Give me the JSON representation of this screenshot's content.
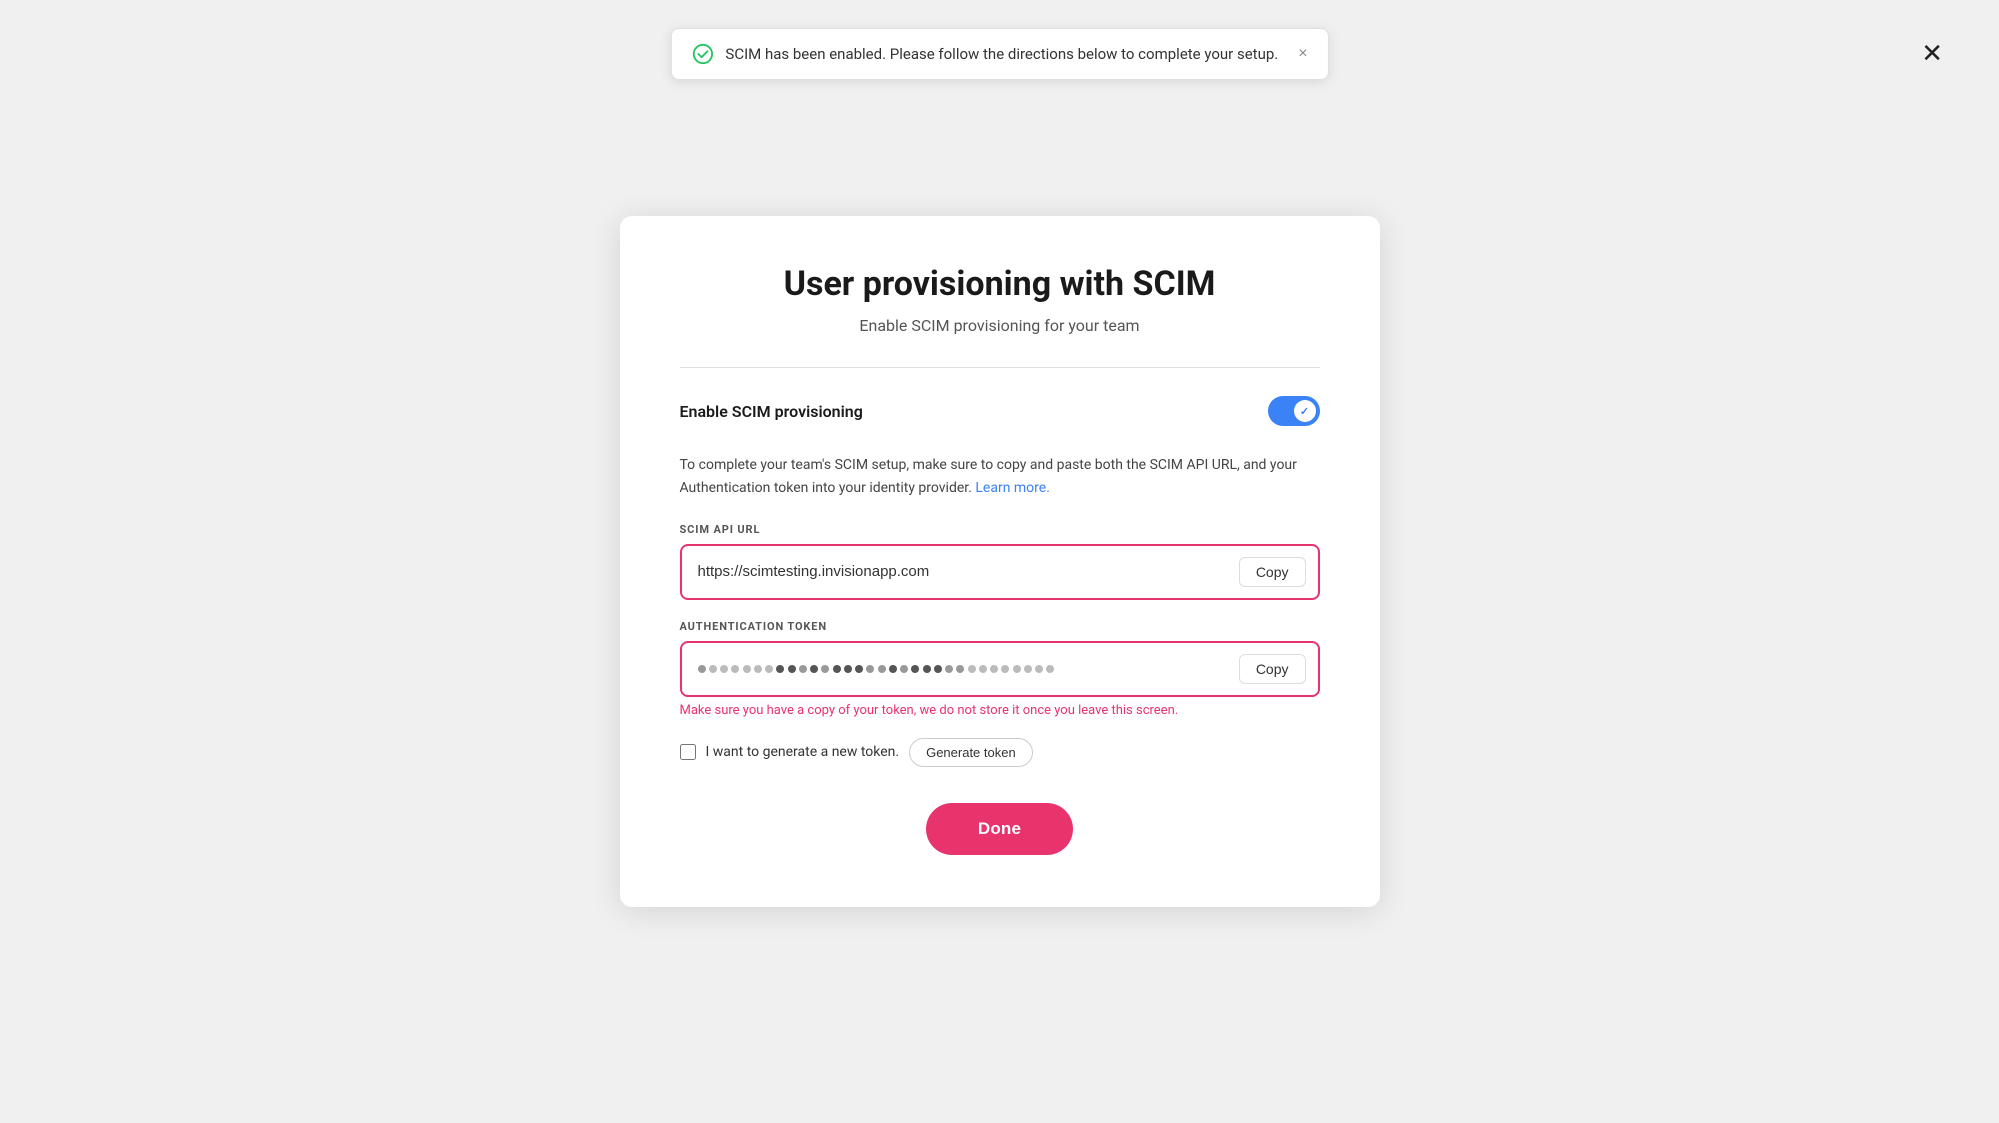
{
  "modal": {
    "title": "User provisioning with SCIM",
    "subtitle": "Enable SCIM provisioning for your team",
    "close_label": "✕"
  },
  "toast": {
    "message": "SCIM has been enabled. Please follow the directions below to complete your setup.",
    "close_label": "×",
    "icon": "check-circle"
  },
  "toggle": {
    "label": "Enable SCIM provisioning",
    "checked": true
  },
  "description": {
    "text": "To complete your team's SCIM setup, make sure to copy and paste both the SCIM API URL, and your Authentication token into your identity provider.",
    "link_text": "Learn more.",
    "link_url": "#"
  },
  "scim_api_url": {
    "label": "SCIM API URL",
    "value": "https://scimtesting.invisionapp.com",
    "copy_label": "Copy"
  },
  "auth_token": {
    "label": "Authentication token",
    "value": "••••••••••••••••••••••••••••••••••••••••••••••••••••••••••••",
    "copy_label": "Copy",
    "warning": "Make sure you have a copy of your token, we do not store it once you leave this screen."
  },
  "new_token": {
    "checkbox_label": "I want to generate a new token.",
    "button_label": "Generate token"
  },
  "done_button": {
    "label": "Done"
  },
  "colors": {
    "accent": "#e8336d",
    "blue": "#3b82f6",
    "toggle_bg": "#3b82f6"
  }
}
